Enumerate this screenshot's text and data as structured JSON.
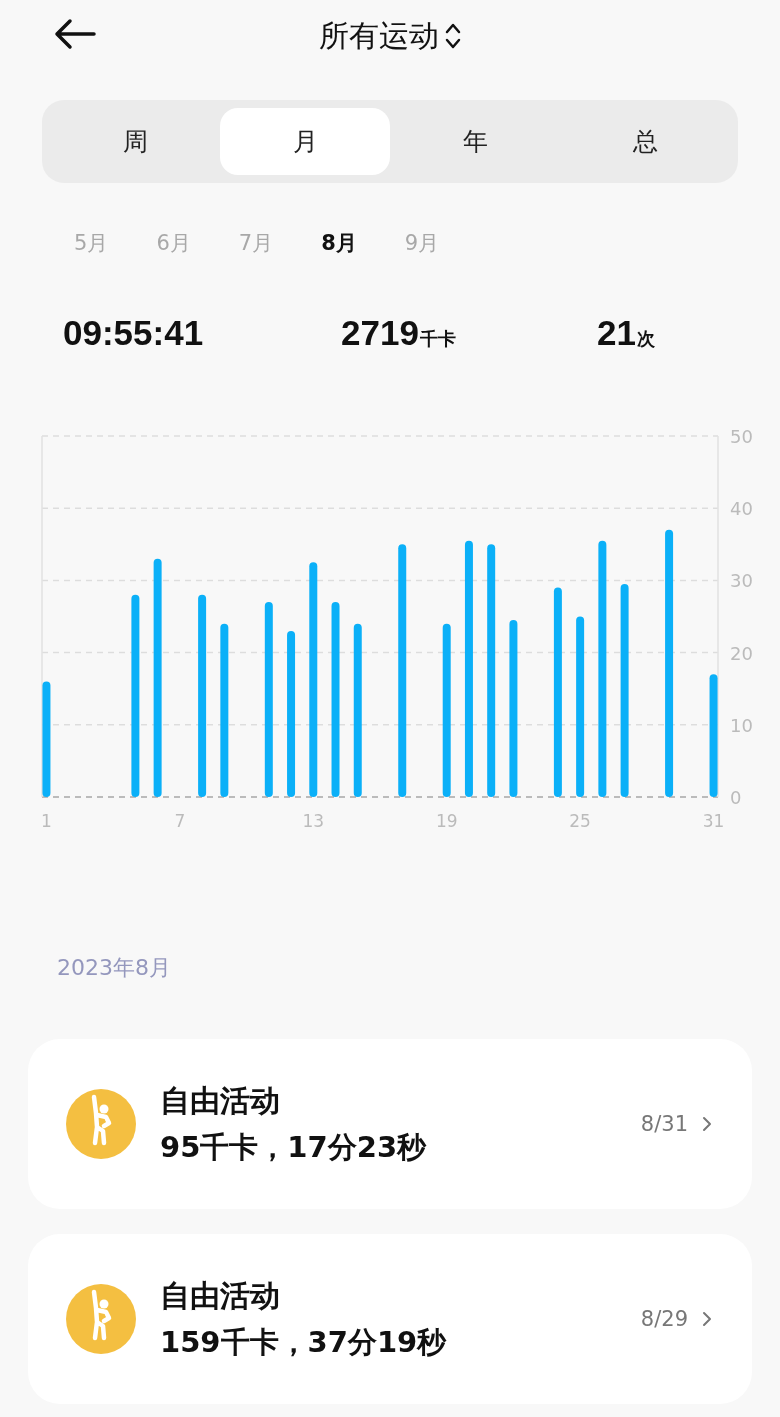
{
  "header": {
    "title": "所有运动"
  },
  "period_tabs": [
    {
      "label": "周",
      "selected": false
    },
    {
      "label": "月",
      "selected": true
    },
    {
      "label": "年",
      "selected": false
    },
    {
      "label": "总",
      "selected": false
    }
  ],
  "months": [
    {
      "label": "5月",
      "selected": false
    },
    {
      "label": "6月",
      "selected": false
    },
    {
      "label": "7月",
      "selected": false
    },
    {
      "label": "8月",
      "selected": true
    },
    {
      "label": "9月",
      "selected": false
    }
  ],
  "stats": [
    {
      "value": "09:55:41"
    },
    {
      "value": "2719",
      "unit": "千卡"
    },
    {
      "value": "21",
      "unit": "次"
    }
  ],
  "chart_data": {
    "type": "bar",
    "x": [
      1,
      5,
      6,
      8,
      9,
      11,
      12,
      13,
      14,
      15,
      17,
      19,
      20,
      21,
      22,
      24,
      25,
      26,
      27,
      29,
      31
    ],
    "grid": true,
    "values": [
      16,
      28,
      33,
      28,
      24,
      27,
      23,
      32.5,
      27,
      24,
      35,
      24,
      35.5,
      35,
      24.5,
      29,
      25,
      35.5,
      29.5,
      37,
      17
    ],
    "xlim": [
      0.8,
      31.2
    ],
    "ylim": [
      0,
      50
    ],
    "yticks": [
      0,
      10,
      20,
      30,
      40,
      50
    ],
    "xticks": [
      1,
      7,
      13,
      19,
      25,
      31
    ]
  },
  "section_title": "2023年8月",
  "records": [
    {
      "name": "自由活动",
      "summary": "95千卡，17分23秒",
      "date": "8/31"
    },
    {
      "name": "自由活动",
      "summary": "159千卡，37分19秒",
      "date": "8/29"
    }
  ]
}
